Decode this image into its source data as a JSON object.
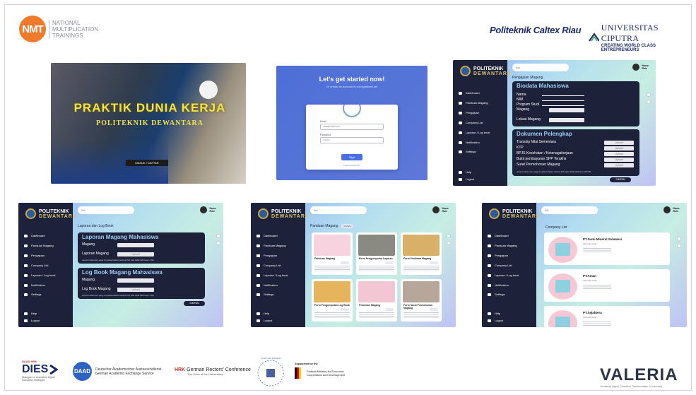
{
  "header": {
    "nmt_mark": "NMT",
    "nmt_lines": [
      "NATIONAL",
      "MULTIPLICATION",
      "TRAININGS"
    ],
    "pcr": "Politeknik Caltex Riau",
    "ciputra_name": "UNIVERSITAS CIPUTRA",
    "ciputra_tag": "CREATING WORLD CLASS ENTREPRENEURS"
  },
  "banner": {
    "title": "PRAKTIK DUNIA KERJA",
    "subtitle": "POLITEKNIK DEWANTARA",
    "button": "MASUK / DAFTAR"
  },
  "login": {
    "heading": "Let's get started now!",
    "subheading": "Or create an account if not registered yet",
    "email_label": "Email",
    "email_value": "mail@mail.com",
    "password_label": "Password",
    "password_value": "••••••••",
    "signin": "Sign",
    "forgot": "Forgot password?"
  },
  "app": {
    "logo_line1": "POLITEKNIK",
    "logo_line2": "DEWANTARA",
    "search_placeholder": "Ask ...",
    "user_name": "Name",
    "user_role": "Role",
    "nav": [
      "Dashboard",
      "Panduan Magang",
      "Pengajuan",
      "Company List",
      "Laporan / Log book",
      "Notification",
      "Settings"
    ],
    "help": "Help",
    "logout": "Logout",
    "save": "SIMPAN"
  },
  "pengajuan": {
    "title": "Pengajuan Magang",
    "biodata_header": "Biodata Mahasiswa",
    "biodata_rows": [
      "Nama",
      "NIM",
      "Program Studi",
      "Magang",
      "Lokasi Magang"
    ],
    "dokumen_header": "Dokumen Pelengkap",
    "dokumen_rows": [
      "Transkip Nilai Sementara",
      "KTP",
      "BPJS Kesehatan / Ketenagakerjaan",
      "Bukti pembayaran SPP Terakhir",
      "Surat Permohonan Magang"
    ],
    "upload": "Upload",
    "note": "seluruh dokumen yang di upload dalam bentuk Pdf, dan tidak lebih dari 100 Mb"
  },
  "laporan": {
    "title": "Laporan dan Log Book",
    "laporan_header": "Laporan Magang Mahasiswa",
    "laporan_rows": [
      "Magang",
      "Laporan Magang"
    ],
    "logbook_header": "Log Book Magang Mahasiswa",
    "logbook_rows": [
      "Magang",
      "Log Book Magang"
    ],
    "upload": "Upload",
    "note": "seluruh dokumen yang di upload dalam bentuk Pdf, dan tidak lebih dari 1 Gb"
  },
  "panduan": {
    "title": "Panduan Magang",
    "filter": "All Data",
    "cards": [
      "Panduan Magang",
      "Form Pengumpulan Laporan",
      "Form Penilaian Magang",
      "Form Pengumpulan Log Book",
      "Pedoman Magang",
      "Form Surat Permohonan Magang"
    ]
  },
  "companies": {
    "title": "Company List",
    "items": [
      {
        "name": "PT.Sumi Mineral Sulawesi",
        "sub": "Informasi Kata"
      },
      {
        "name": "PT.Aman",
        "sub": "Informasi Kata"
      },
      {
        "name": "PT.Sejahtera",
        "sub": "Informasi Kata"
      }
    ]
  },
  "footer": {
    "dies_top": "DAAD HRK",
    "dies": "DIES",
    "dies_sub": "Dialogue on Innovative Higher Education Strategies",
    "daad": "DAAD",
    "daad_de": "Deutscher Akademischer Austauschdienst",
    "daad_en": "German Academic Exchange Service",
    "hrk_mark": "HRK",
    "hrk": "German Rectors' Conference",
    "hrk_sub": "The Voice of the Universities",
    "potsdam": "Universität Potsdam",
    "bmz_supported": "Supported by the",
    "bmz": "Federal Ministry for Economic Cooperation and Development",
    "valeria": "VALERIA",
    "valeria_sub": "Vocational Higher Education Transformation in Indonesia"
  },
  "colors": {
    "sidebar": "#1d2139",
    "accent": "#ef7a2c",
    "login_bg": "#4d6fd6"
  }
}
